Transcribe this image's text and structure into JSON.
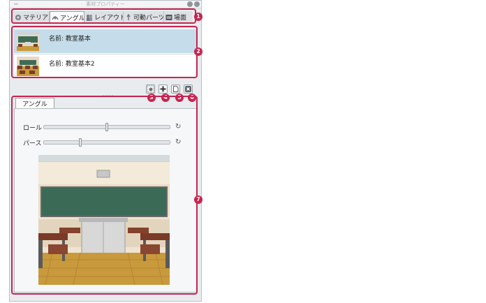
{
  "window": {
    "title": "素材プロパティー",
    "grip": "⇔"
  },
  "tabs": [
    {
      "label": "マテリアル",
      "icon": "material-icon",
      "active": false
    },
    {
      "label": "アングル",
      "icon": "angle-icon",
      "active": true
    },
    {
      "label": "レイアウト",
      "icon": "layout-icon",
      "active": false
    },
    {
      "label": "可動パーツ",
      "icon": "movable-parts-icon",
      "active": false
    },
    {
      "label": "場面",
      "icon": "scene-icon",
      "active": false
    }
  ],
  "angle_list": [
    {
      "label": "名前: 教室基本",
      "selected": true
    },
    {
      "label": "名前: 教室基本2",
      "selected": false
    }
  ],
  "toolbar": {
    "buttons": [
      "register-angle-icon",
      "add-icon",
      "duplicate-icon",
      "delete-icon"
    ],
    "dots": "....."
  },
  "angle_tab": {
    "label": "アングル"
  },
  "sliders": [
    {
      "label": "ロール",
      "value": 0.5,
      "reset_icon": "↻"
    },
    {
      "label": "パース",
      "value": 0.28,
      "reset_icon": "↻"
    }
  ],
  "callouts": [
    "1",
    "2",
    "3",
    "4",
    "5",
    "6",
    "7"
  ],
  "colors": {
    "accent": "#c8234f",
    "selection": "#c5dcea",
    "panel": "#e9ecef"
  }
}
